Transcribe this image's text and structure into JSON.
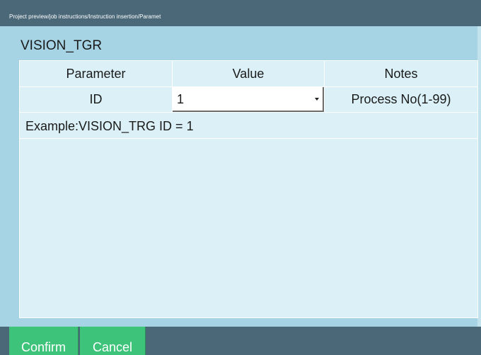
{
  "breadcrumb": "Project preview/job instructions/Instruction insertion/Paramet",
  "dialog": {
    "title": "VISION_TGR"
  },
  "table": {
    "headers": {
      "parameter": "Parameter",
      "value": "Value",
      "notes": "Notes"
    },
    "rows": [
      {
        "parameter": "ID",
        "value": "1",
        "notes": "Process No(1-99)"
      }
    ],
    "example": "Example:VISION_TRG ID = 1"
  },
  "buttons": {
    "confirm": "Confirm",
    "cancel": "Cancel"
  },
  "colors": {
    "header_bar": "#4a6878",
    "panel_bg": "#a6d4e4",
    "grid_bg": "#dbf1f7",
    "button_green": "#3ec37a"
  },
  "icons": {
    "value_dropdown": "chevron-down-icon"
  }
}
